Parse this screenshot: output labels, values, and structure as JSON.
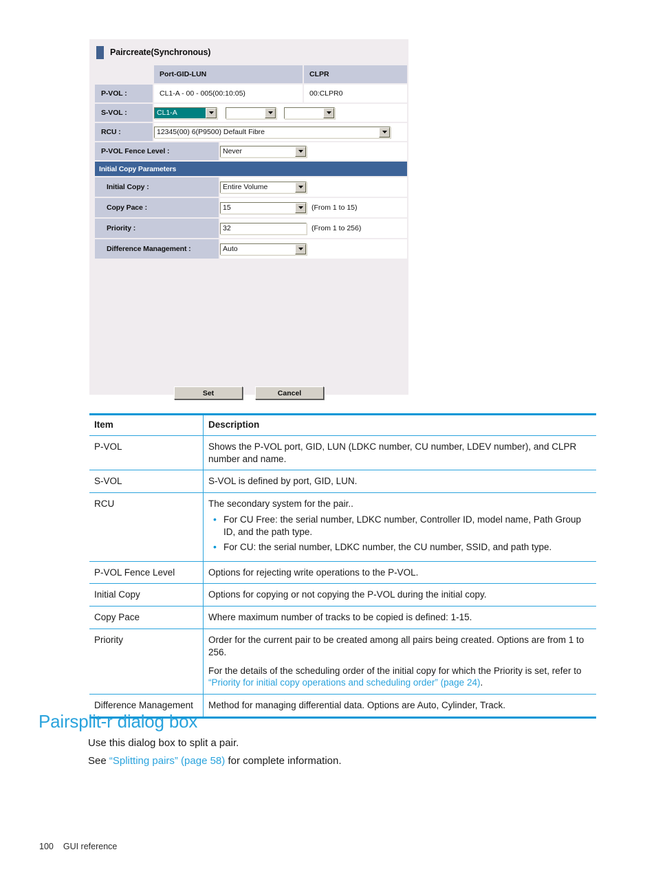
{
  "dialog": {
    "title": "Paircreate(Synchronous)",
    "columns": {
      "blank": "",
      "port_gid_lun": "Port-GID-LUN",
      "clpr": "CLPR"
    },
    "rows": {
      "pvol": {
        "label": "P-VOL :",
        "port_gid_lun": "CL1-A - 00 - 005(00:10:05)",
        "clpr": "00:CLPR0"
      },
      "svol": {
        "label": "S-VOL :",
        "port_value": "CL1-A",
        "gid_value": "",
        "lun_value": ""
      },
      "rcu": {
        "label": "RCU :",
        "value": "12345(00) 6(P9500) Default Fibre"
      },
      "fence": {
        "label": "P-VOL Fence Level :",
        "value": "Never"
      }
    },
    "section_banner": "Initial Copy Parameters",
    "initial_copy": {
      "label": "Initial Copy :",
      "value": "Entire Volume"
    },
    "copy_pace": {
      "label": "Copy Pace :",
      "value": "15",
      "hint": "(From 1 to 15)"
    },
    "priority": {
      "label": "Priority :",
      "value": "32",
      "hint": "(From 1 to 256)"
    },
    "difference_management": {
      "label": "Difference Management :",
      "value": "Auto"
    },
    "buttons": {
      "set": "Set",
      "cancel": "Cancel"
    },
    "colors": {
      "title_swatch": "#42618f",
      "label_cell": "#c6cadb",
      "banner": "#3d6398",
      "selected_combo": "#008080",
      "dialog_bg": "#f0ecef"
    }
  },
  "reference_table": {
    "headers": {
      "item": "Item",
      "description": "Description"
    },
    "rows": [
      {
        "item": "P-VOL",
        "description": "Shows the P-VOL port, GID, LUN (LDKC number, CU number, LDEV number), and CLPR number and name."
      },
      {
        "item": "S-VOL",
        "description": "S-VOL is defined by port, GID, LUN."
      },
      {
        "item": "RCU",
        "description": "The secondary system for the pair..",
        "bullets": [
          "For CU Free: the serial number, LDKC number, Controller ID, model name, Path Group ID, and the path type.",
          "For CU: the serial number, LDKC number, the CU number, SSID, and path type."
        ]
      },
      {
        "item": "P-VOL Fence Level",
        "description": "Options for rejecting write operations to the P-VOL."
      },
      {
        "item": "Initial Copy",
        "description": "Options for copying or not copying the P-VOL during the initial copy."
      },
      {
        "item": "Copy Pace",
        "description": "Where maximum number of tracks to be copied is defined: 1-15."
      },
      {
        "item": "Priority",
        "description": "Order for the current pair to be created among all pairs being created. Options are from 1 to 256.",
        "description2_pre": "For the details of the scheduling order of the initial copy for which the Priority is set, refer to ",
        "description2_link": "“Priority for initial copy operations and scheduling order” (page 24)",
        "description2_post": "."
      },
      {
        "item": "Difference Management",
        "description": "Method for managing differential data. Options are Auto, Cylinder, Track."
      }
    ]
  },
  "section": {
    "heading": "Pairsplit-r dialog box",
    "paragraph1": "Use this dialog box to split a pair.",
    "paragraph2_pre": "See ",
    "paragraph2_link": "“Splitting pairs” (page 58)",
    "paragraph2_post": " for complete information."
  },
  "footer": {
    "page_number": "100",
    "chapter": "GUI reference"
  }
}
